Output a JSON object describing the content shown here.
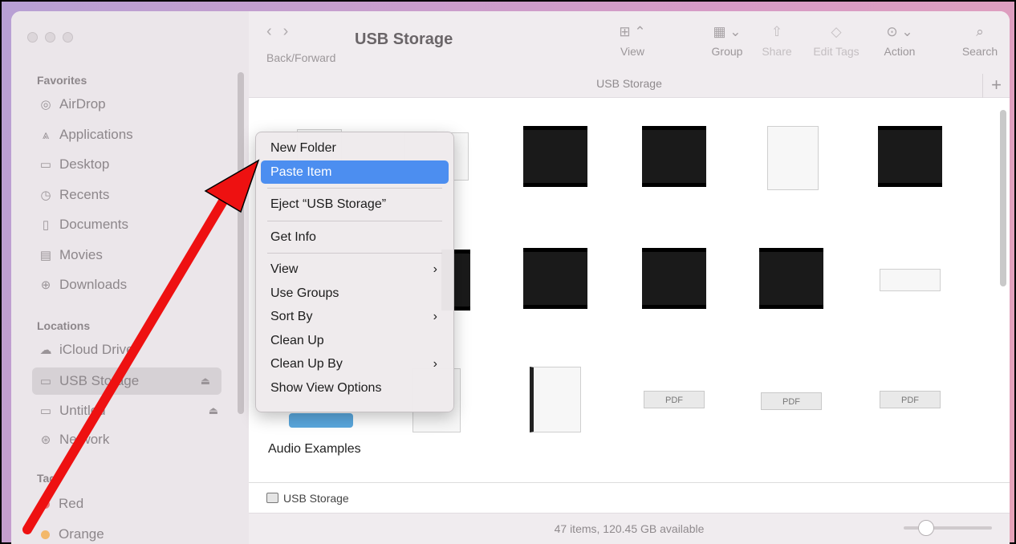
{
  "window": {
    "title": "USB Storage",
    "path_title": "USB Storage",
    "new_tab_glyph": "+"
  },
  "toolbar": {
    "back_forward_label": "Back/Forward",
    "back_forward_glyphs": "‹›",
    "view_label": "View",
    "group_label": "Group",
    "share_label": "Share",
    "edit_tags_label": "Edit Tags",
    "action_label": "Action",
    "search_label": "Search",
    "icons": {
      "view": "grid-icon",
      "group": "group-icon",
      "share": "share-icon",
      "edit_tags": "tag-icon",
      "action": "ellipsis-circle-icon",
      "search": "search-icon"
    }
  },
  "sidebar": {
    "favorites_heading": "Favorites",
    "favorites": [
      {
        "label": "AirDrop",
        "icon": "airdrop-icon"
      },
      {
        "label": "Applications",
        "icon": "applications-icon"
      },
      {
        "label": "Desktop",
        "icon": "desktop-icon"
      },
      {
        "label": "Recents",
        "icon": "clock-icon"
      },
      {
        "label": "Documents",
        "icon": "document-icon"
      },
      {
        "label": "Movies",
        "icon": "film-icon"
      },
      {
        "label": "Downloads",
        "icon": "download-icon"
      }
    ],
    "locations_heading": "Locations",
    "locations": [
      {
        "label": "iCloud Drive",
        "icon": "cloud-icon"
      },
      {
        "label": "USB Storage",
        "icon": "drive-icon",
        "selected": true,
        "eject": "⏏"
      },
      {
        "label": "Untitled",
        "icon": "drive-icon",
        "eject": "⏏"
      },
      {
        "label": "Network",
        "icon": "globe-icon"
      }
    ],
    "tags_heading": "Tags",
    "tags": [
      {
        "label": "Red",
        "color": "#f07a7a"
      },
      {
        "label": "Orange",
        "color": "#f3b86a"
      }
    ]
  },
  "context_menu": {
    "items": [
      {
        "label": "New Folder"
      },
      {
        "label": "Paste Item",
        "highlighted": true
      },
      {
        "separator": true
      },
      {
        "label": "Eject “USB Storage”"
      },
      {
        "separator": true
      },
      {
        "label": "Get Info"
      },
      {
        "separator": true
      },
      {
        "label": "View",
        "submenu": true
      },
      {
        "label": "Use Groups"
      },
      {
        "label": "Sort By",
        "submenu": true
      },
      {
        "label": "Clean Up"
      },
      {
        "label": "Clean Up By",
        "submenu": true
      },
      {
        "label": "Show View Options"
      }
    ],
    "submenu_glyph": "›"
  },
  "content": {
    "visible_label": "Audio Examples",
    "pdf_badge": "PDF"
  },
  "path_bar": {
    "drive_label": "USB Storage"
  },
  "status_bar": {
    "text": "47 items, 120.45 GB available",
    "zoom_slider": 0.2
  },
  "annotation": {
    "arrow_color": "#ee1111"
  }
}
